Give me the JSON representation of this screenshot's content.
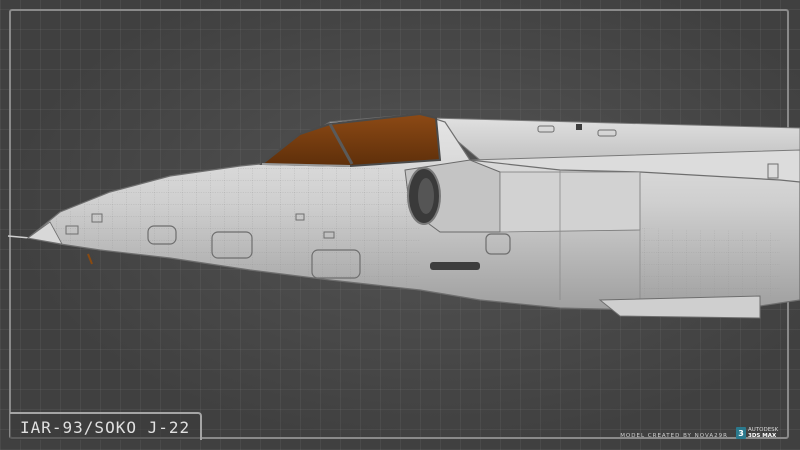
{
  "title": "IAR-93/SOKO J-22",
  "credit": "MODEL CREATED BY NOVA29R",
  "logo": {
    "line1": "AUTODESK",
    "line2": "3DS MAX",
    "mark": "3",
    "icon": "autodesk-3ds-max-logo"
  },
  "colors": {
    "background": "#404040",
    "frame": "#8a8a8a",
    "fuselage": "#cfcfcf",
    "canopy": "#7a3f10"
  }
}
